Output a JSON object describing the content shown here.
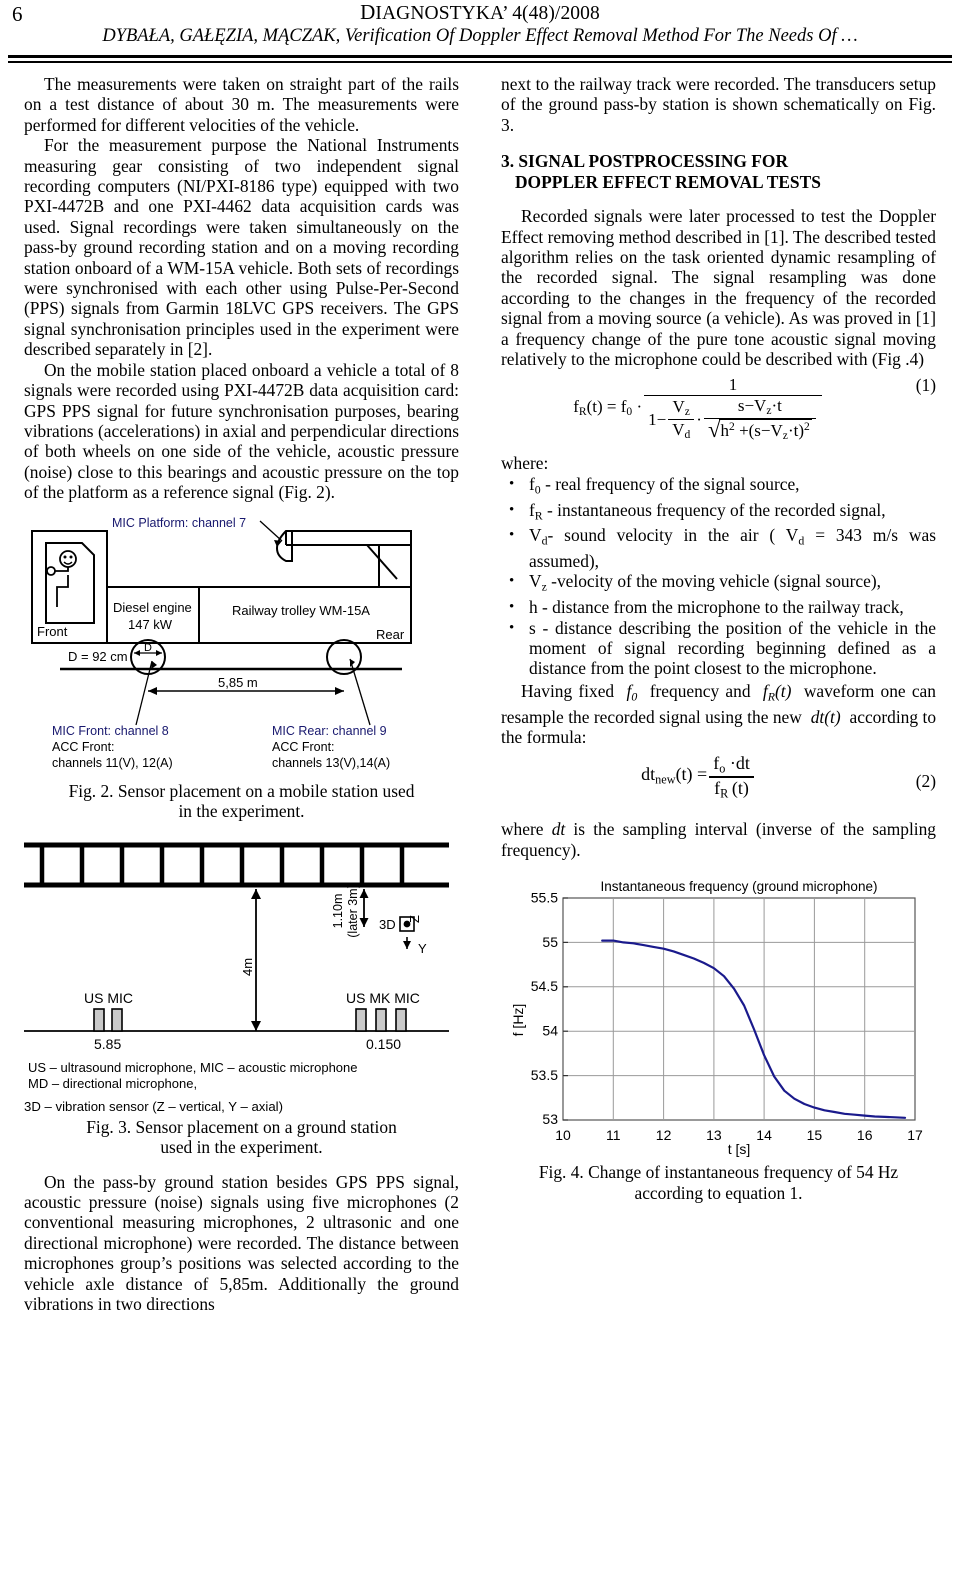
{
  "header": {
    "page_number": "6",
    "journal_prefix": "D",
    "journal_rest": "IAGNOSTYKA",
    "journal_issue": "’ 4(48)/2008",
    "authors_line": "DYBAŁA, GAŁĘZIA, MĄCZAK, Verification Of Doppler Effect Removal Method For The Needs Of …"
  },
  "left_column": {
    "p1": "The measurements were taken on straight part of the rails on a test distance of about 30 m. The measurements were performed for different velocities of the vehicle.",
    "p2": "For the measurement purpose the National Instruments measuring gear consisting of two independent signal recording computers (NI/PXI-8186 type) equipped with two PXI-4472B and one PXI-4462 data acquisition cards was used. Signal recordings were taken simultaneously on the pass-by ground recording station and on a moving recording station onboard of a WM-15A vehicle. Both sets of recordings were synchronised with each other using Pulse-Per-Second (PPS) signals from Garmin 18LVC GPS receivers. The GPS signal synchronisation principles used in the experiment were described separately in [2].",
    "p3": "On the mobile station placed onboard a vehicle a total of 8 signals were recorded using PXI-4472B data acquisition card: GPS PPS signal for future synchronisation purposes, bearing vibrations (accelerations) in axial and perpendicular directions of both wheels on one side of the vehicle, acoustic pressure (noise) close to this bearings and acoustic pressure on the top of the platform as a reference signal (Fig. 2).",
    "p4": "On the pass-by ground station besides GPS PPS signal, acoustic pressure (noise) signals using five microphones (2 conventional measuring microphones, 2 ultrasonic and one directional microphone) were recorded. The distance between microphones group’s positions was selected according to the vehicle axle distance of 5,85m. Additionally the ground vibrations in two directions"
  },
  "right_column": {
    "p1": "next to the railway track were recorded. The transducers setup of the ground pass-by station is shown schematically on Fig. 3.",
    "section_title_l1": "3. SIGNAL POSTPROCESSING FOR",
    "section_title_l2": "DOPPLER EFFECT REMOVAL TESTS",
    "p2": "Recorded signals were later processed to test the Doppler Effect removing method described in [1]. The described tested algorithm relies on the task oriented dynamic resampling of the recorded signal. The signal resampling was done according to the changes in the frequency of the recorded signal from a moving source (a vehicle). As was proved in [1] a frequency change of the pure tone acoustic signal moving relatively to the microphone could be described with (Fig .4)",
    "where_label": "where:",
    "where_items": [
      "f0 - real frequency of the signal source,",
      "fR - instantaneous frequency of the recorded signal,",
      "Vd - sound velocity in the air ( Vd = 343 m/s was assumed),",
      "Vz -velocity of the moving vehicle (signal source),",
      "h - distance from the microphone to the railway track,",
      "s - distance describing the position of the vehicle in the moment of signal recording beginning defined as a distance from the point closest to the microphone."
    ],
    "p3_a": "Having fixed",
    "p3_b": "frequency and",
    "p3_c": "waveform one can resample the recorded signal using the new",
    "p3_d": "according to the formula:",
    "p4": "where dt is the sampling interval (inverse of the sampling frequency)."
  },
  "equations": {
    "eq1_number": "(1)",
    "eq1_lhs": "fᴿ(t) = f₀ ·",
    "eq1_outer_num": "1",
    "eq1_inner_lead": "1−",
    "eq1_vz": "V",
    "eq1_vz_sub": "z",
    "eq1_vd": "V",
    "eq1_vd_sub": "d",
    "eq1_dot": "·",
    "eq1_frac2_num": "s−Vᶻ·t",
    "eq1_radical_body": "h² +(s−Vᶻ·t)²",
    "eq2_number": "(2)",
    "eq2_lhs": "dt",
    "eq2_lhs_sub": "new",
    "eq2_lhs_tail": "(t) =",
    "eq2_num": "fₒ ·dt",
    "eq2_den": "fᴿ (t)"
  },
  "figure2": {
    "label_platform": "MIC Platform: channel 7",
    "label_front_box": "Front",
    "label_engine_l1": "Diesel engine",
    "label_engine_l2": "147 kW",
    "label_trolley": "Railway trolley WM-15A",
    "label_rear_box": "Rear",
    "label_diameter": "D = 92 cm",
    "label_wheel_d": "D",
    "label_axle": "5,85 m",
    "label_front_mic_l1": "MIC Front: channel 8",
    "label_front_mic_l2": "ACC Front:",
    "label_front_mic_l3": "channels 11(V), 12(A)",
    "label_rear_mic_l1": "MIC Rear: channel 9",
    "label_rear_mic_l2": "ACC Front:",
    "label_rear_mic_l3": "channels 13(V),14(A)",
    "caption_l1": "Fig. 2. Sensor placement on a mobile station used",
    "caption_l2": "in the experiment.",
    "label_color": "#18186e"
  },
  "figure3": {
    "label_4m": "4m",
    "label_110m_l1": "1.10m",
    "label_110m_l2": "(later 3m)",
    "label_3d": "3D",
    "label_z": "Z",
    "label_y": "Y",
    "label_us_mic": "US  MIC",
    "label_us_mk_mic": "US MK MIC",
    "label_dist_left": "5.85",
    "label_dist_right": "0.150",
    "legend_l1": "US – ultrasound microphone, MIC – acoustic microphone",
    "legend_l2": "MD – directional microphone,",
    "legend_l3": "3D  – vibration sensor (Z – vertical, Y – axial)",
    "caption_l1": "Fig. 3. Sensor placement on a ground station",
    "caption_l2": "used in the experiment."
  },
  "figure4": {
    "caption_l1": "Fig. 4. Change of instantaneous frequency of 54 Hz",
    "caption_l2": "according to equation 1."
  },
  "chart_data": {
    "type": "line",
    "title": "Instantaneous frequency (ground microphone)",
    "xlabel": "t  [s]",
    "ylabel": "f [Hz]",
    "xlim": [
      10,
      17
    ],
    "ylim": [
      53,
      55.5
    ],
    "xticks": [
      10,
      11,
      12,
      13,
      14,
      15,
      16,
      17
    ],
    "yticks": [
      53,
      53.5,
      54,
      54.5,
      55,
      55.5
    ],
    "grid": true,
    "legend": null,
    "line_color": "#1a1a8c",
    "series": [
      {
        "name": "instantaneous frequency",
        "x": [
          10.78,
          11.0,
          11.2,
          11.4,
          11.6,
          11.8,
          12.0,
          12.2,
          12.4,
          12.6,
          12.8,
          13.0,
          13.2,
          13.4,
          13.6,
          13.8,
          14.0,
          14.2,
          14.4,
          14.6,
          14.8,
          15.0,
          15.2,
          15.4,
          15.6,
          15.8,
          16.0,
          16.2,
          16.4,
          16.6,
          16.8
        ],
        "y": [
          55.02,
          55.02,
          55.0,
          54.99,
          54.97,
          54.95,
          54.93,
          54.9,
          54.86,
          54.82,
          54.77,
          54.71,
          54.62,
          54.48,
          54.29,
          54.02,
          53.73,
          53.49,
          53.33,
          53.24,
          53.18,
          53.14,
          53.11,
          53.09,
          53.07,
          53.06,
          53.05,
          53.04,
          53.035,
          53.03,
          53.025
        ]
      }
    ]
  }
}
